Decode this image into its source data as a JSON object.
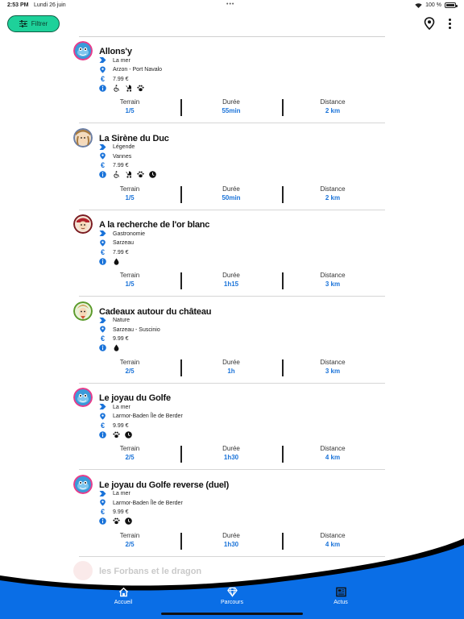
{
  "status_bar": {
    "time": "2:53 PM",
    "date": "Lundi 26 juin",
    "battery": "100 %"
  },
  "toolbar": {
    "filter_label": "Filtrer",
    "filter_icon": "sliders-icon",
    "location_icon": "location-pin-icon",
    "more_icon": "more-vertical-icon"
  },
  "stat_labels": {
    "terrain": "Terrain",
    "duree": "Durée",
    "distance": "Distance"
  },
  "routes": [
    {
      "title": "Allons'y",
      "theme": "La mer",
      "location": "Arzon - Port Navalo",
      "price": "7.99 €",
      "amenities": [
        "wheelchair",
        "stroller",
        "paw"
      ],
      "terrain": "1/5",
      "duree": "55min",
      "distance": "2 km",
      "avatar": "mascot-blue"
    },
    {
      "title": "La Sirène du Duc",
      "theme": "Légende",
      "location": "Vannes",
      "price": "7.99 €",
      "amenities": [
        "wheelchair",
        "stroller",
        "paw",
        "clock"
      ],
      "terrain": "1/5",
      "duree": "50min",
      "distance": "2 km",
      "avatar": "mascot-brown"
    },
    {
      "title": "A la recherche de l'or blanc",
      "theme": "Gastronomie",
      "location": "Sarzeau",
      "price": "7.99 €",
      "amenities": [
        "drop"
      ],
      "terrain": "1/5",
      "duree": "1h15",
      "distance": "3 km",
      "avatar": "mascot-red"
    },
    {
      "title": "Cadeaux autour du château",
      "theme": "Nature",
      "location": "Sarzeau - Suscinio",
      "price": "9.99 €",
      "amenities": [
        "drop"
      ],
      "terrain": "2/5",
      "duree": "1h",
      "distance": "3 km",
      "avatar": "mascot-green"
    },
    {
      "title": "Le joyau du Golfe",
      "theme": "La mer",
      "location": "Larmor-Baden Île de Berder",
      "price": "9.99 €",
      "amenities": [
        "paw",
        "clock"
      ],
      "terrain": "2/5",
      "duree": "1h30",
      "distance": "4 km",
      "avatar": "mascot-blue"
    },
    {
      "title": "Le joyau du Golfe reverse (duel)",
      "theme": "La mer",
      "location": "Larmor-Baden Île de Berder",
      "price": "9.99 €",
      "amenities": [
        "paw",
        "clock"
      ],
      "terrain": "2/5",
      "duree": "1h30",
      "distance": "4 km",
      "avatar": "mascot-blue"
    }
  ],
  "partial_route": {
    "title": "les Forbans et le dragon"
  },
  "bottom_nav": [
    {
      "label": "Accueil",
      "icon": "home-icon"
    },
    {
      "label": "Parcours",
      "icon": "diamond-icon"
    },
    {
      "label": "Actus",
      "icon": "newspaper-icon"
    }
  ],
  "colors": {
    "accent_green": "#1ed19a",
    "accent_blue": "#1a73d9",
    "nav_blue": "#0a6ee6"
  }
}
